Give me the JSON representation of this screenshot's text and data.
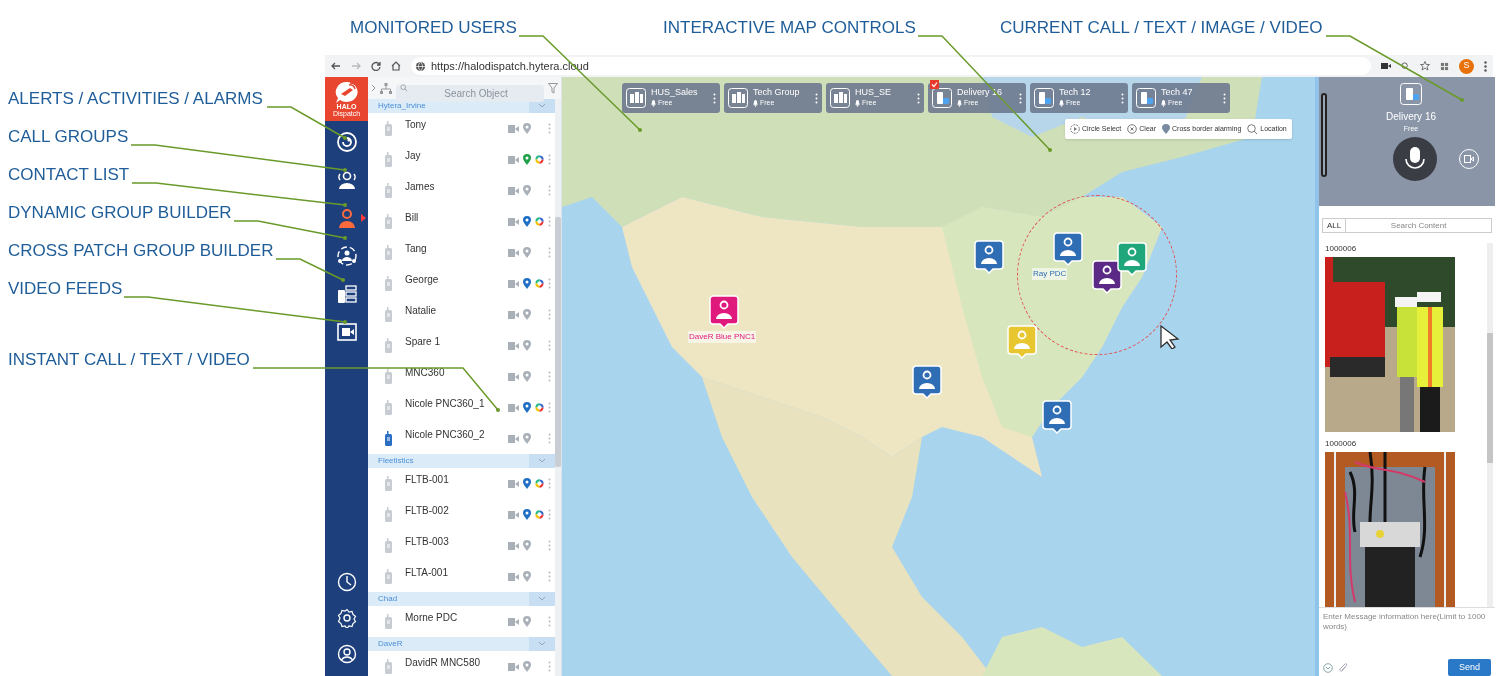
{
  "top_callouts": [
    "MONITORED USERS",
    "INTERACTIVE MAP CONTROLS",
    "CURRENT CALL / TEXT / IMAGE / VIDEO"
  ],
  "left_callouts": [
    "ALERTS / ACTIVITIES / ALARMS",
    "CALL GROUPS",
    "CONTACT LIST",
    "DYNAMIC GROUP BUILDER",
    "CROSS PATCH GROUP BUILDER",
    "VIDEO FEEDS",
    "INSTANT CALL / TEXT / VIDEO"
  ],
  "browser": {
    "url": "https://halodispatch.hytera.cloud",
    "profile_initial": "S"
  },
  "sidebar": {
    "logo_top": "HALO",
    "logo_bottom": "Dispatch",
    "items": [
      {
        "kind": "alerts",
        "selected": false
      },
      {
        "kind": "call_groups",
        "selected": false
      },
      {
        "kind": "contacts",
        "selected": true
      },
      {
        "kind": "dynamic",
        "selected": false
      },
      {
        "kind": "patch",
        "selected": false
      },
      {
        "kind": "video",
        "selected": false
      }
    ]
  },
  "contacts": {
    "search_placeholder": "Search Object",
    "groups": [
      {
        "name": "Hytera_Irvine",
        "members": [
          {
            "name": "Tony",
            "gps": false,
            "ring": false,
            "highlighted": false
          },
          {
            "name": "Jay",
            "gps": true,
            "color": "#21a04a",
            "ring": true,
            "highlighted": false
          },
          {
            "name": "James",
            "gps": false,
            "ring": false,
            "highlighted": false
          },
          {
            "name": "Bill",
            "gps": true,
            "color": "#1f6fc4",
            "ring": true,
            "highlighted": false
          },
          {
            "name": "Tang",
            "gps": false,
            "ring": false,
            "highlighted": false
          },
          {
            "name": "George",
            "gps": true,
            "color": "#1f6fc4",
            "ring": true,
            "highlighted": false
          },
          {
            "name": "Natalie",
            "gps": false,
            "ring": false,
            "highlighted": false
          },
          {
            "name": "Spare 1",
            "gps": false,
            "ring": false,
            "highlighted": false
          },
          {
            "name": "MNC360",
            "gps": false,
            "ring": false,
            "highlighted": false
          },
          {
            "name": "Nicole PNC360_1",
            "gps": true,
            "color": "#1f6fc4",
            "ring": true,
            "highlighted": false
          },
          {
            "name": "Nicole PNC360_2",
            "gps": false,
            "ring": false,
            "highlighted": true
          }
        ]
      },
      {
        "name": "Fleetistics",
        "members": [
          {
            "name": "FLTB-001",
            "gps": true,
            "color": "#1f6fc4",
            "ring": true,
            "highlighted": false
          },
          {
            "name": "FLTB-002",
            "gps": true,
            "color": "#1f6fc4",
            "ring": true,
            "highlighted": false
          },
          {
            "name": "FLTB-003",
            "gps": false,
            "ring": false,
            "highlighted": false
          },
          {
            "name": "FLTA-001",
            "gps": false,
            "ring": false,
            "highlighted": false
          }
        ]
      },
      {
        "name": "Chad",
        "members": [
          {
            "name": "Morne PDC",
            "gps": false,
            "ring": false,
            "highlighted": false
          }
        ]
      },
      {
        "name": "DaveR",
        "members": [
          {
            "name": "DavidR MNC580",
            "gps": false,
            "ring": false,
            "highlighted": false
          }
        ]
      }
    ]
  },
  "monitored": [
    {
      "name": "HUS_Sales",
      "status": "Free",
      "kind": "group",
      "checked": false
    },
    {
      "name": "Tech Group",
      "status": "Free",
      "kind": "group",
      "checked": false
    },
    {
      "name": "HUS_SE",
      "status": "Free",
      "kind": "group",
      "checked": false
    },
    {
      "name": "Delivery 16",
      "status": "Free",
      "kind": "device",
      "checked": true
    },
    {
      "name": "Tech 12",
      "status": "Free",
      "kind": "device",
      "checked": false
    },
    {
      "name": "Tech 47",
      "status": "Free",
      "kind": "device",
      "checked": false
    }
  ],
  "map_controls": [
    {
      "label": "Circle Select",
      "kind": "circle"
    },
    {
      "label": "Clear",
      "kind": "clear"
    },
    {
      "label": "Cross border alarming",
      "kind": "alarm"
    },
    {
      "label": "Location",
      "kind": "location"
    }
  ],
  "map": {
    "markers": [
      {
        "color": "#e0197d",
        "label": "DaveR Blue PNC1"
      },
      {
        "color": "#2f6db5"
      },
      {
        "color": "#2f6db5",
        "label": "Ray PDC"
      },
      {
        "color": "#5b2a86"
      },
      {
        "color": "#1fa67a"
      },
      {
        "color": "#e8c630"
      },
      {
        "color": "#2f6db5"
      },
      {
        "color": "#2f6db5"
      }
    ]
  },
  "current_call": {
    "name": "Delivery 16",
    "status": "Free"
  },
  "messages": {
    "filter": "ALL",
    "search_placeholder": "Search Content",
    "items": [
      {
        "sender": "1000006",
        "kind": "site"
      },
      {
        "sender": "1000006",
        "kind": "panel"
      }
    ],
    "input_placeholder": "Enter Message information here(Limit to 1000 words)",
    "send": "Send"
  }
}
